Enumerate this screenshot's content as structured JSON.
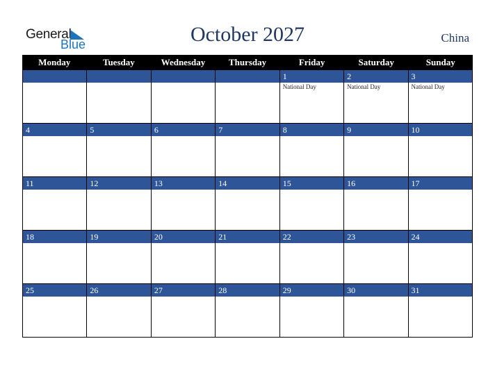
{
  "logo": {
    "line1": "General",
    "line2": "Blue"
  },
  "title": "October 2027",
  "country": "China",
  "weekdays": [
    "Monday",
    "Tuesday",
    "Wednesday",
    "Thursday",
    "Friday",
    "Saturday",
    "Sunday"
  ],
  "weeks": [
    [
      {
        "day": "",
        "holiday": ""
      },
      {
        "day": "",
        "holiday": ""
      },
      {
        "day": "",
        "holiday": ""
      },
      {
        "day": "",
        "holiday": ""
      },
      {
        "day": "1",
        "holiday": "National Day"
      },
      {
        "day": "2",
        "holiday": "National Day"
      },
      {
        "day": "3",
        "holiday": "National Day"
      }
    ],
    [
      {
        "day": "4",
        "holiday": ""
      },
      {
        "day": "5",
        "holiday": ""
      },
      {
        "day": "6",
        "holiday": ""
      },
      {
        "day": "7",
        "holiday": ""
      },
      {
        "day": "8",
        "holiday": ""
      },
      {
        "day": "9",
        "holiday": ""
      },
      {
        "day": "10",
        "holiday": ""
      }
    ],
    [
      {
        "day": "11",
        "holiday": ""
      },
      {
        "day": "12",
        "holiday": ""
      },
      {
        "day": "13",
        "holiday": ""
      },
      {
        "day": "14",
        "holiday": ""
      },
      {
        "day": "15",
        "holiday": ""
      },
      {
        "day": "16",
        "holiday": ""
      },
      {
        "day": "17",
        "holiday": ""
      }
    ],
    [
      {
        "day": "18",
        "holiday": ""
      },
      {
        "day": "19",
        "holiday": ""
      },
      {
        "day": "20",
        "holiday": ""
      },
      {
        "day": "21",
        "holiday": ""
      },
      {
        "day": "22",
        "holiday": ""
      },
      {
        "day": "23",
        "holiday": ""
      },
      {
        "day": "24",
        "holiday": ""
      }
    ],
    [
      {
        "day": "25",
        "holiday": ""
      },
      {
        "day": "26",
        "holiday": ""
      },
      {
        "day": "27",
        "holiday": ""
      },
      {
        "day": "28",
        "holiday": ""
      },
      {
        "day": "29",
        "holiday": ""
      },
      {
        "day": "30",
        "holiday": ""
      },
      {
        "day": "31",
        "holiday": ""
      }
    ]
  ],
  "colors": {
    "header": "#000000",
    "band": "#2e5597",
    "title": "#1f3864",
    "logo_blue": "#1e74bb"
  }
}
